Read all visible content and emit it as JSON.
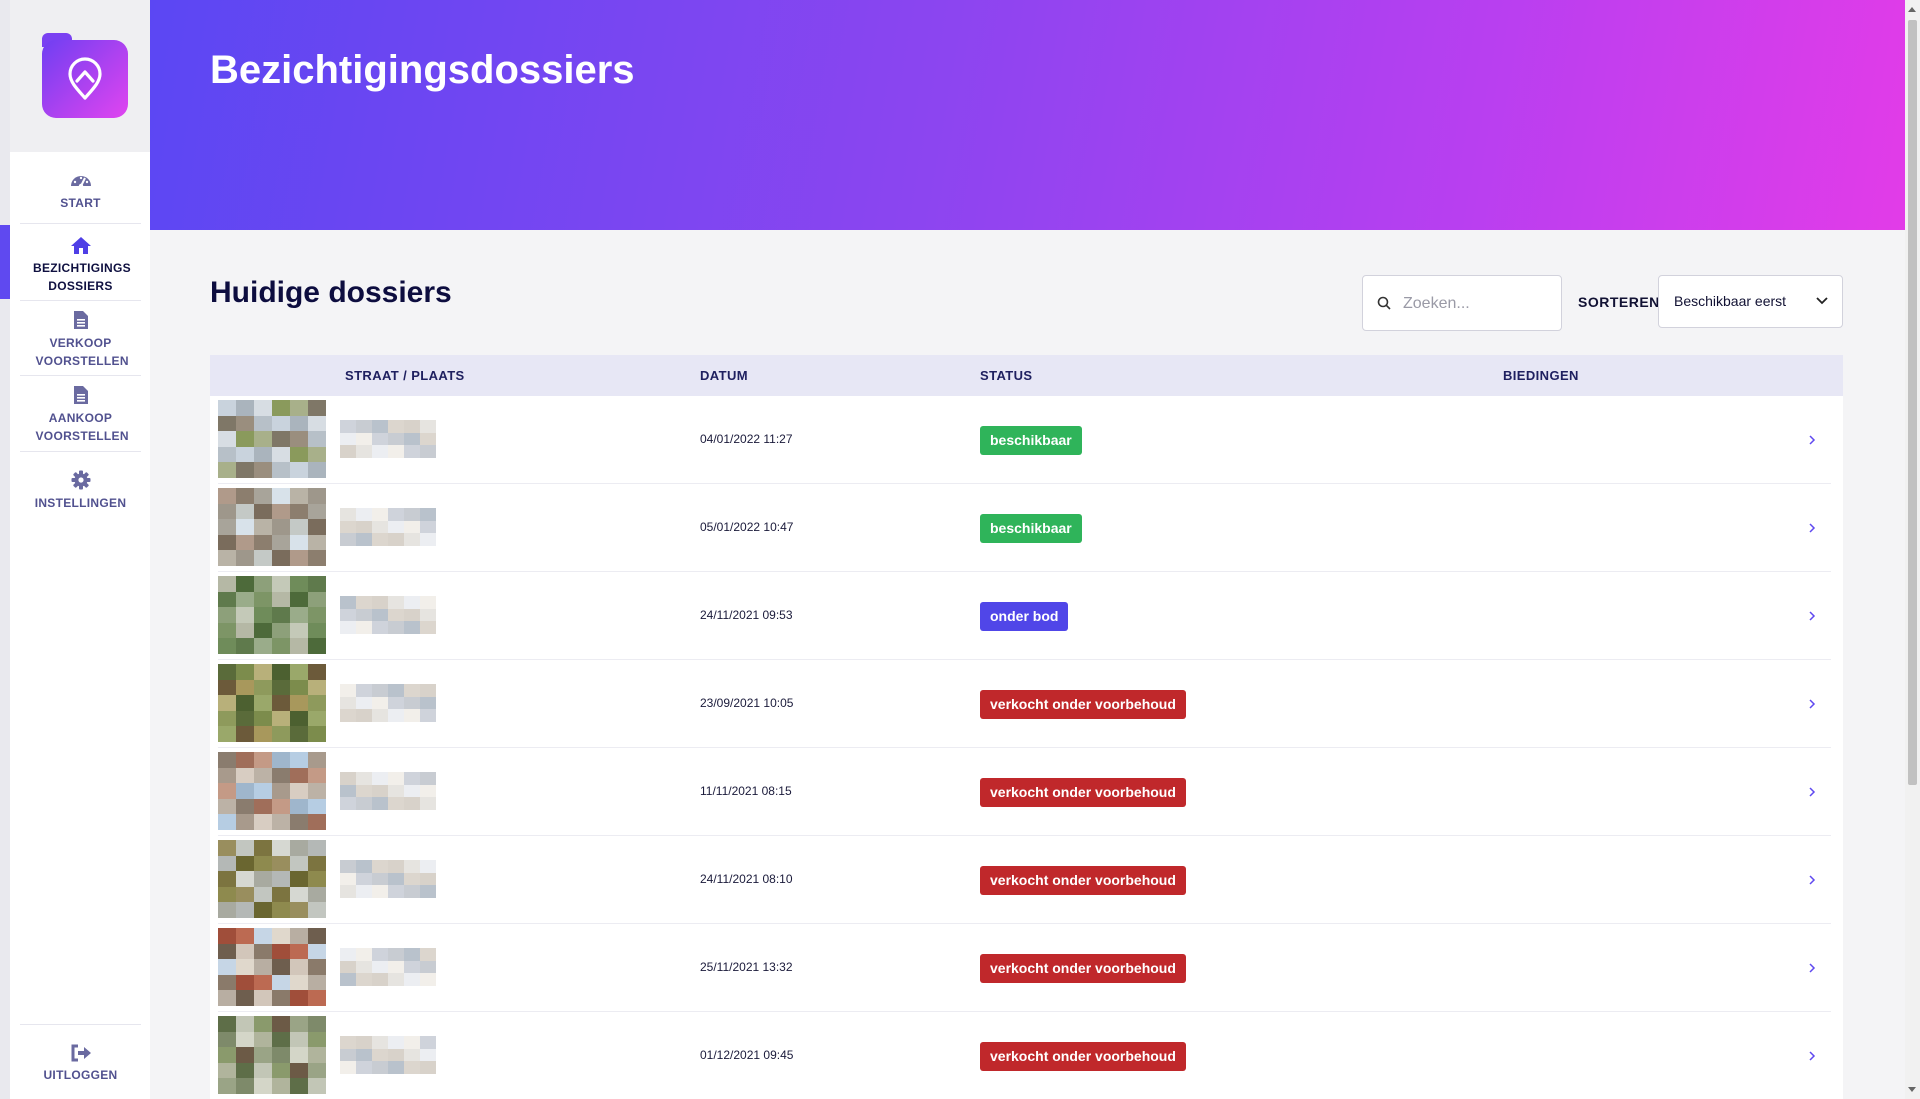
{
  "page": {
    "title": "Bezichtigingsdossiers"
  },
  "sidebar": {
    "items": [
      {
        "label": "START",
        "icon": "speedometer-icon"
      },
      {
        "label": "BEZICHTIGINGS DOSSIERS",
        "icon": "home-icon",
        "active": true
      },
      {
        "label": "VERKOOP VOORSTELLEN",
        "icon": "document-icon"
      },
      {
        "label": "AANKOOP VOORSTELLEN",
        "icon": "document-icon"
      },
      {
        "label": "INSTELLINGEN",
        "icon": "gear-icon"
      }
    ],
    "logout": {
      "label": "UITLOGGEN",
      "icon": "sign-out-icon"
    }
  },
  "main": {
    "section_title": "Huidige dossiers",
    "search": {
      "placeholder": "Zoeken..."
    },
    "sort": {
      "label": "SORTEREN",
      "value": "Beschikbaar eerst"
    },
    "table": {
      "columns": [
        "STRAAT / PLAATS",
        "DATUM",
        "STATUS",
        "BIEDINGEN"
      ],
      "rows": [
        {
          "date": "04/01/2022 11:27",
          "status": "beschikbaar",
          "status_color": "#2fb45a"
        },
        {
          "date": "05/01/2022 10:47",
          "status": "beschikbaar",
          "status_color": "#2fb45a"
        },
        {
          "date": "24/11/2021 09:53",
          "status": "onder bod",
          "status_color": "#5046e8"
        },
        {
          "date": "23/09/2021 10:05",
          "status": "verkocht onder voorbehoud",
          "status_color": "#c0282b"
        },
        {
          "date": "11/11/2021 08:15",
          "status": "verkocht onder voorbehoud",
          "status_color": "#c0282b"
        },
        {
          "date": "24/11/2021 08:10",
          "status": "verkocht onder voorbehoud",
          "status_color": "#c0282b"
        },
        {
          "date": "25/11/2021 13:32",
          "status": "verkocht onder voorbehoud",
          "status_color": "#c0282b"
        },
        {
          "date": "01/12/2021 09:45",
          "status": "verkocht onder voorbehoud",
          "status_color": "#c0282b"
        }
      ]
    }
  },
  "colors": {
    "accent": "#5f49f0",
    "header_gradient": [
      "#5b47f3",
      "#e23ce8"
    ],
    "available": "#2fb45a",
    "under_offer": "#5046e8",
    "sold_conditional": "#c0282b"
  }
}
